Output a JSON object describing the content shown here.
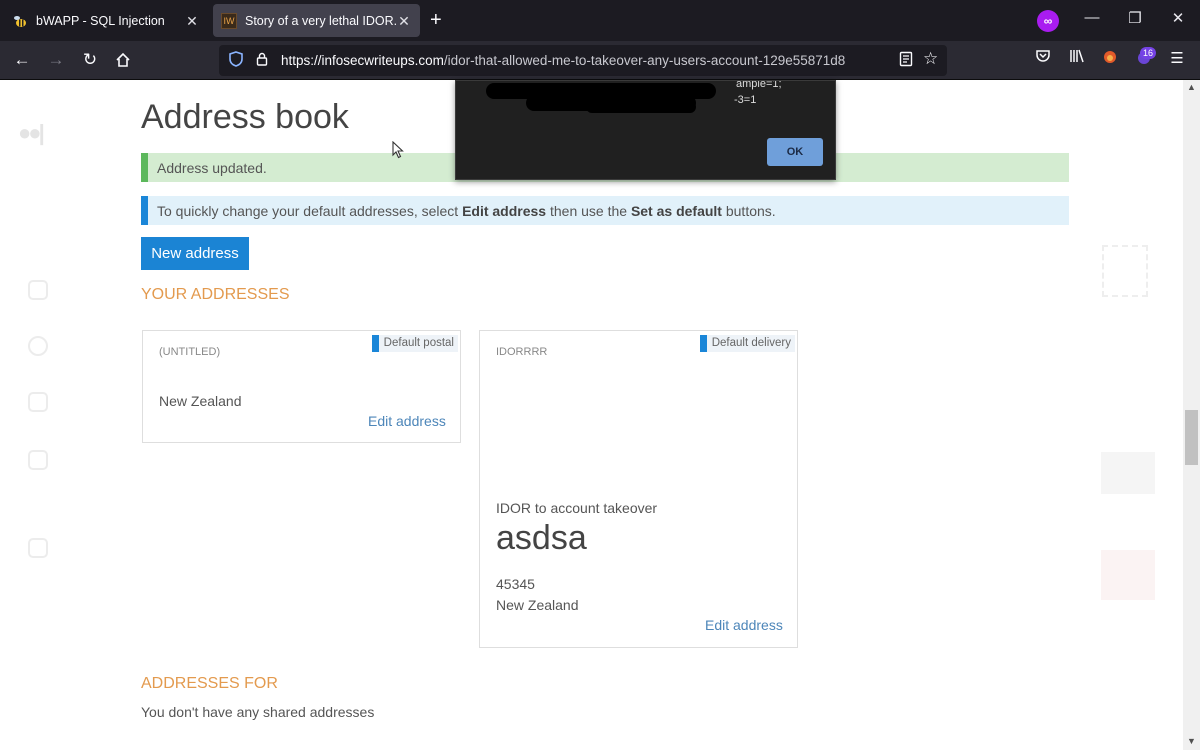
{
  "browser": {
    "tabs": [
      {
        "title": "bWAPP - SQL Injection",
        "favicon": "bee-icon",
        "active": false
      },
      {
        "title": "Story of a very lethal IDOR.. Hel",
        "favicon_text": "IW",
        "active": true
      }
    ],
    "close_glyph": "✕",
    "new_tab_glyph": "+",
    "url_domain": "https://infosecwriteups.com",
    "url_path": "/idor-that-allowed-me-to-takeover-any-users-account-129e55871d8",
    "extension_badge": "16",
    "accent_color": "#a91cf0"
  },
  "page": {
    "title": "Address book",
    "alert_success": "Address updated.",
    "alert_info": {
      "prefix": "To quickly change your default addresses, select ",
      "edit_address": "Edit address",
      "middle": " then use the ",
      "set_default": "Set as default",
      "suffix": " buttons."
    },
    "new_address_button": "New address",
    "your_addresses_heading": "YOUR ADDRESSES",
    "cards": [
      {
        "tag": "Default postal",
        "name": "(UNTITLED)",
        "country": "New Zealand",
        "edit": "Edit address"
      },
      {
        "tag": "Default delivery",
        "name": "IDORRRR",
        "company": "IDOR to account takeover",
        "street": "asdsa",
        "postcode": "45345",
        "country": "New Zealand",
        "edit": "Edit address"
      }
    ],
    "addresses_for_heading": "ADDRESSES FOR",
    "shared_text": "You don't have any shared addresses"
  },
  "dialog": {
    "line1_visible": "ample=1;",
    "line2_visible": "-3=1",
    "ok_label": "OK"
  },
  "colors": {
    "primary_button": "#1b84d4",
    "heading_orange": "#e39a4e",
    "success_bg": "#d4ecd1",
    "info_bg": "#e1f1fa"
  }
}
